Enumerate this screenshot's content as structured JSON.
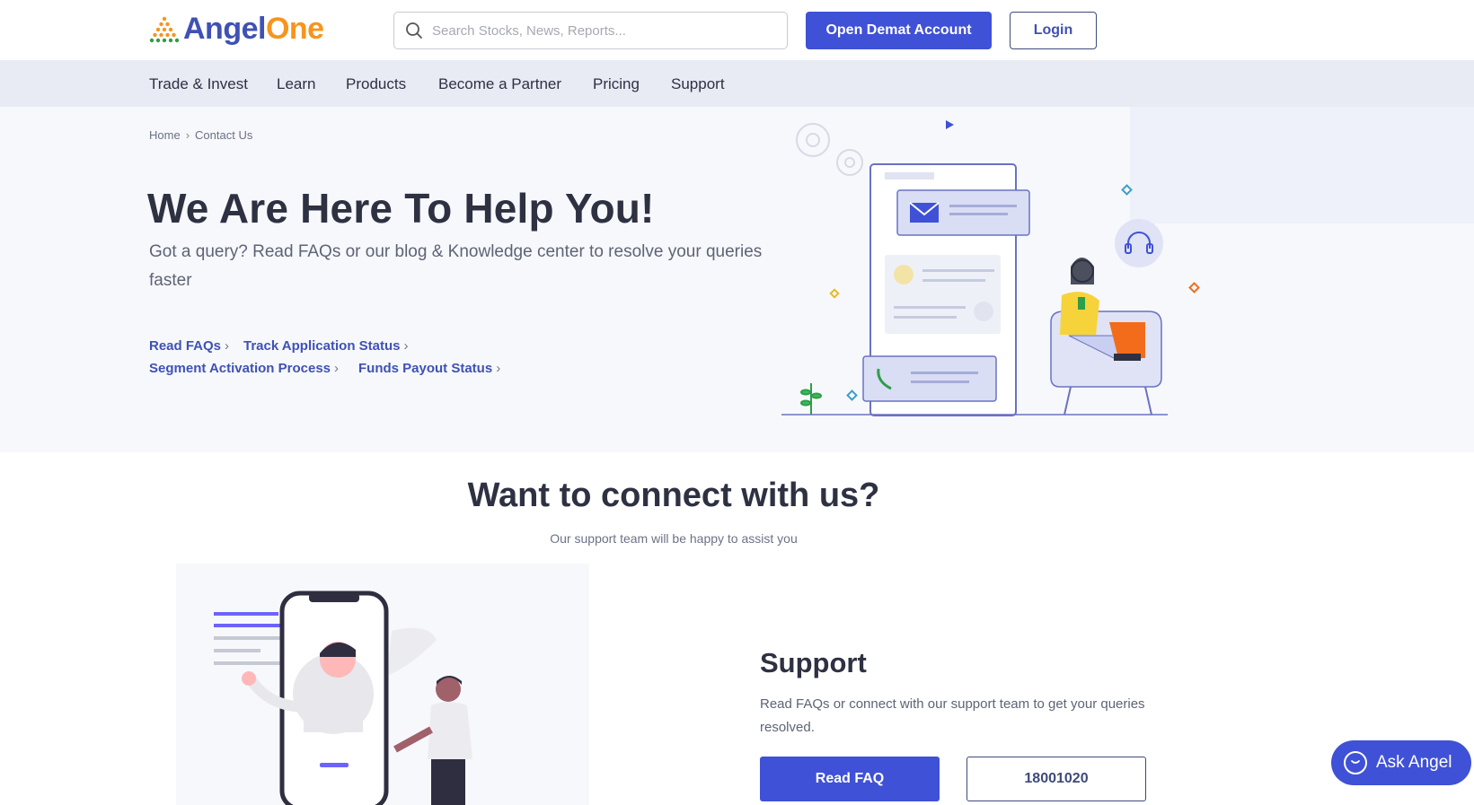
{
  "header": {
    "logo_part1": "Angel",
    "logo_part2": "One",
    "search_placeholder": "Search Stocks, News, Reports...",
    "open_demat_label": "Open Demat Account",
    "login_label": "Login"
  },
  "nav": {
    "items": [
      "Trade & Invest",
      "Learn",
      "Products",
      "Become a Partner",
      "Pricing",
      "Support"
    ]
  },
  "breadcrumb": {
    "home": "Home",
    "separator": "›",
    "current": "Contact Us"
  },
  "hero": {
    "title": "We Are Here To Help You!",
    "subtitle": "Got a query? Read FAQs or our blog & Knowledge center to resolve your queries faster",
    "links": [
      "Read FAQs",
      "Track Application Status",
      "Segment Activation Process",
      "Funds Payout Status"
    ],
    "chevron": "›"
  },
  "connect": {
    "title": "Want to connect with us?",
    "subtitle": "Our support team will be happy to assist you"
  },
  "support": {
    "title": "Support",
    "text": "Read FAQs or connect with our support team to get your queries resolved.",
    "faq_button": "Read FAQ",
    "phone_button": "18001020"
  },
  "chat_widget": {
    "label": "Ask Angel"
  },
  "colors": {
    "brand_blue": "#3f51d6",
    "brand_orange": "#f7941d",
    "nav_bg": "#e8ebf4",
    "hero_bg": "#f7f8fc"
  }
}
